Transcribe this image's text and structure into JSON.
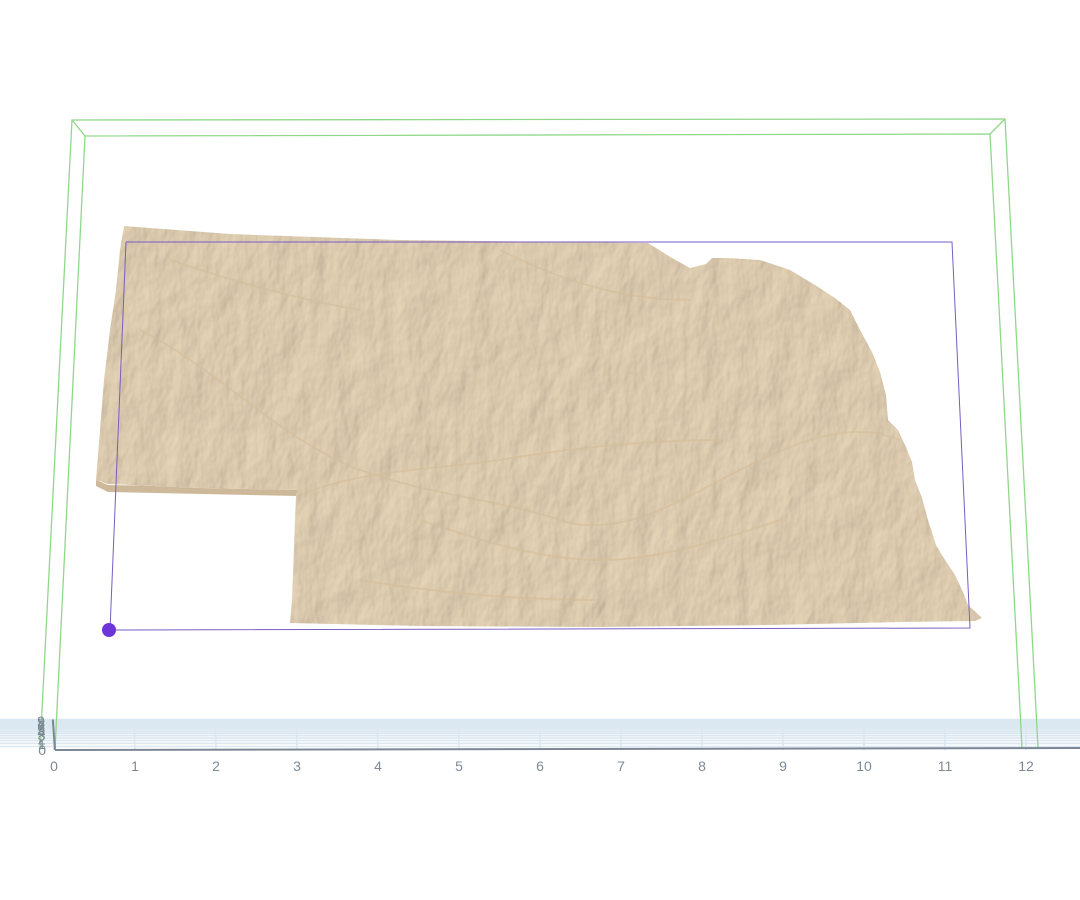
{
  "viewer": {
    "x_axis": {
      "ticks": [
        "0",
        "1",
        "2",
        "3",
        "4",
        "5",
        "6",
        "7",
        "8",
        "9",
        "10",
        "11",
        "12"
      ]
    },
    "y_axis": {
      "ticks": [
        "0",
        "1",
        "2",
        "3",
        "4",
        "5",
        "6",
        "7",
        "8",
        "9"
      ]
    },
    "model": {
      "shape": "Nebraska",
      "color": "#eedbbd",
      "shadow_color": "#cdb89a"
    },
    "build_volume_color": "#8fd88a",
    "selection_box_color": "#7a5cc4",
    "anchor_handle_color": "#6b35d8",
    "grid_color": "#dbe7f1",
    "axis_color": "#7b8794"
  }
}
